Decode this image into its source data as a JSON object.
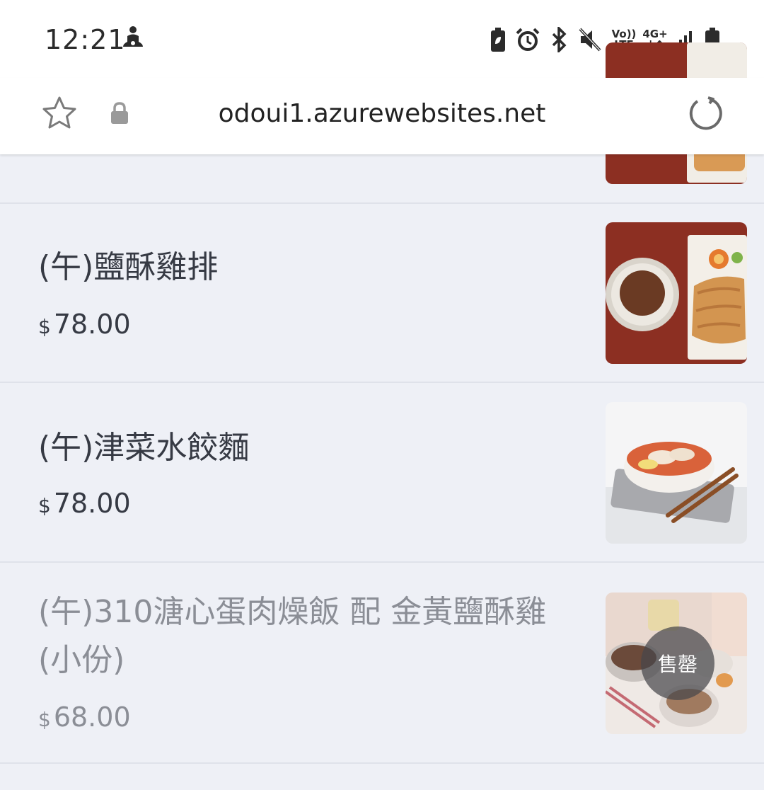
{
  "status_bar": {
    "time": "12:21",
    "icons": [
      "meditation-icon",
      "battery-saver-icon",
      "alarm-icon",
      "bluetooth-icon",
      "mute-icon",
      "volte-icon",
      "4g-data-icon",
      "signal-icon",
      "battery-icon"
    ],
    "volte_top": "Vo))",
    "volte_bottom": "LTE",
    "network_top": "4G+",
    "network_bottom": "↓↑"
  },
  "browser": {
    "url": "odoui1.azurewebsites.net",
    "icons": [
      "star-icon",
      "lock-icon",
      "reload-icon"
    ]
  },
  "menu": {
    "items": [
      {
        "name": "(午)鹽酥雞排",
        "currency": "$",
        "price": "78.00",
        "sold_out": false
      },
      {
        "name": "(午)津菜水餃麵",
        "currency": "$",
        "price": "78.00",
        "sold_out": false
      },
      {
        "name": "(午)310溏心蛋肉燥飯 配 金黃鹽酥雞(小份)",
        "currency": "$",
        "price": "68.00",
        "sold_out": true,
        "badge": "售罄"
      }
    ]
  },
  "colors": {
    "page_bg": "#eef0f6",
    "text": "#363a44",
    "dim_text": "#8b8e96",
    "divider": "#dfe2ea"
  }
}
